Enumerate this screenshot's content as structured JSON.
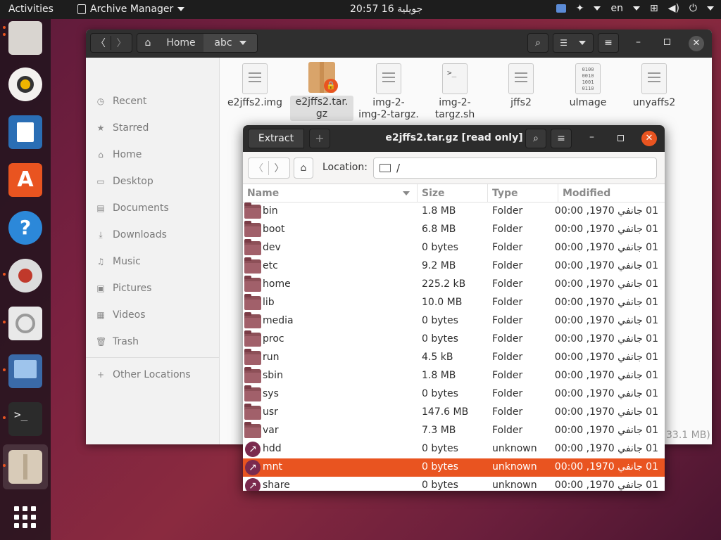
{
  "topbar": {
    "activities": "Activities",
    "app_name": "Archive Manager",
    "clock": "20:57  16 جويلية",
    "lang": "en"
  },
  "files_window": {
    "path": [
      "Home",
      "abc"
    ],
    "sidebar": [
      {
        "label": "Recent",
        "icon": "clock-icon"
      },
      {
        "label": "Starred",
        "icon": "star-icon"
      },
      {
        "label": "Home",
        "icon": "home-icon"
      },
      {
        "label": "Desktop",
        "icon": "desktop-icon"
      },
      {
        "label": "Documents",
        "icon": "documents-icon"
      },
      {
        "label": "Downloads",
        "icon": "downloads-icon"
      },
      {
        "label": "Music",
        "icon": "music-icon"
      },
      {
        "label": "Pictures",
        "icon": "pictures-icon"
      },
      {
        "label": "Videos",
        "icon": "videos-icon"
      },
      {
        "label": "Trash",
        "icon": "trash-icon"
      },
      {
        "label": "Other Locations",
        "icon": "plus-icon"
      }
    ],
    "files": [
      {
        "name": "e2jffs2.img",
        "icon": "document-icon"
      },
      {
        "name": "e2jffs2.tar.gz",
        "icon": "archive-locked-icon"
      },
      {
        "name": "img-2-targz.",
        "icon": "document-icon"
      },
      {
        "name": "img-2-targz.sh",
        "icon": "script-icon"
      },
      {
        "name": "jffs2",
        "icon": "document-icon"
      },
      {
        "name": "uImage",
        "icon": "binary-icon"
      },
      {
        "name": "unyaffs2",
        "icon": "document-icon"
      }
    ],
    "status_fragment": "33.1 MB)"
  },
  "archive_window": {
    "extract_label": "Extract",
    "title": "e2jffs2.tar.gz [read only]",
    "location_label": "Location:",
    "location_value": "/",
    "columns": [
      "Name",
      "Size",
      "Type",
      "Modified"
    ],
    "rows": [
      {
        "name": "bin",
        "size": "1.8 MB",
        "type": "Folder",
        "modified": "01 جانفي 1970, 00:00",
        "kind": "folder"
      },
      {
        "name": "boot",
        "size": "6.8 MB",
        "type": "Folder",
        "modified": "01 جانفي 1970, 00:00",
        "kind": "folder"
      },
      {
        "name": "dev",
        "size": "0 bytes",
        "type": "Folder",
        "modified": "01 جانفي 1970, 00:00",
        "kind": "folder"
      },
      {
        "name": "etc",
        "size": "9.2 MB",
        "type": "Folder",
        "modified": "01 جانفي 1970, 00:00",
        "kind": "folder"
      },
      {
        "name": "home",
        "size": "225.2 kB",
        "type": "Folder",
        "modified": "01 جانفي 1970, 00:00",
        "kind": "folder"
      },
      {
        "name": "lib",
        "size": "10.0 MB",
        "type": "Folder",
        "modified": "01 جانفي 1970, 00:00",
        "kind": "folder"
      },
      {
        "name": "media",
        "size": "0 bytes",
        "type": "Folder",
        "modified": "01 جانفي 1970, 00:00",
        "kind": "folder"
      },
      {
        "name": "proc",
        "size": "0 bytes",
        "type": "Folder",
        "modified": "01 جانفي 1970, 00:00",
        "kind": "folder"
      },
      {
        "name": "run",
        "size": "4.5 kB",
        "type": "Folder",
        "modified": "01 جانفي 1970, 00:00",
        "kind": "folder"
      },
      {
        "name": "sbin",
        "size": "1.8 MB",
        "type": "Folder",
        "modified": "01 جانفي 1970, 00:00",
        "kind": "folder"
      },
      {
        "name": "sys",
        "size": "0 bytes",
        "type": "Folder",
        "modified": "01 جانفي 1970, 00:00",
        "kind": "folder"
      },
      {
        "name": "usr",
        "size": "147.6 MB",
        "type": "Folder",
        "modified": "01 جانفي 1970, 00:00",
        "kind": "folder"
      },
      {
        "name": "var",
        "size": "7.3 MB",
        "type": "Folder",
        "modified": "01 جانفي 1970, 00:00",
        "kind": "folder"
      },
      {
        "name": "hdd",
        "size": "0 bytes",
        "type": "unknown",
        "modified": "01 جانفي 1970, 00:00",
        "kind": "link"
      },
      {
        "name": "mnt",
        "size": "0 bytes",
        "type": "unknown",
        "modified": "01 جانفي 1970, 00:00",
        "kind": "link",
        "selected": true
      },
      {
        "name": "share",
        "size": "0 bytes",
        "type": "unknown",
        "modified": "01 جانفي 1970, 00:00",
        "kind": "link"
      }
    ]
  },
  "colors": {
    "accent": "#e95420",
    "headerbar": "#2c2c2c",
    "folder": "#a1606a"
  }
}
